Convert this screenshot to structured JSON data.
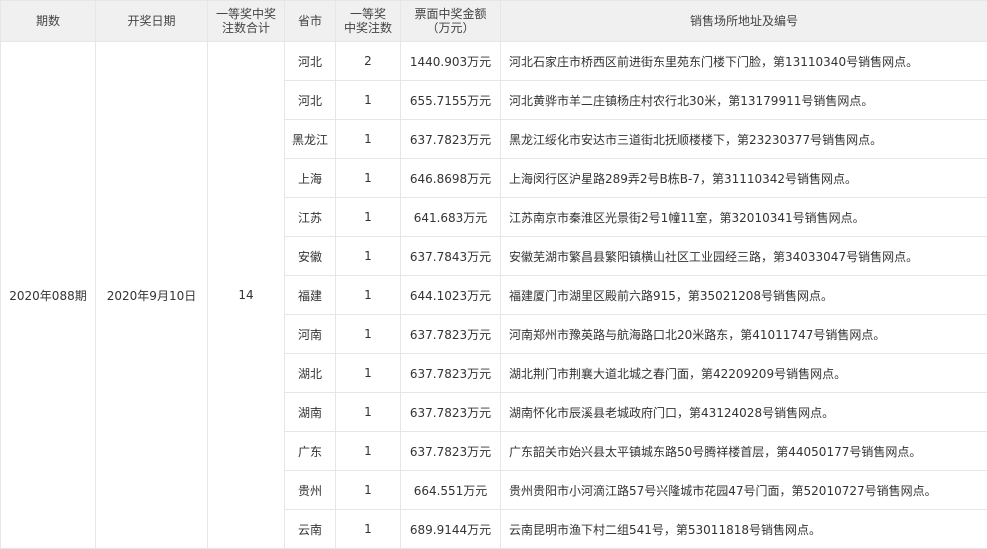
{
  "headers": {
    "period": "期数",
    "date": "开奖日期",
    "total_line1": "一等奖中奖",
    "total_line2": "注数合计",
    "province": "省市",
    "count_line1": "一等奖",
    "count_line2": "中奖注数",
    "amount_line1": "票面中奖金额",
    "amount_line2": "（万元）",
    "address": "销售场所地址及编号"
  },
  "draw": {
    "period": "2020年088期",
    "date": "2020年9月10日",
    "total": "14"
  },
  "rows": [
    {
      "province": "河北",
      "count": "2",
      "amount": "1440.903万元",
      "address": "河北石家庄市桥西区前进街东里苑东门楼下门脸，第13110340号销售网点。"
    },
    {
      "province": "河北",
      "count": "1",
      "amount": "655.7155万元",
      "address": "河北黄骅市羊二庄镇杨庄村农行北30米，第13179911号销售网点。"
    },
    {
      "province": "黑龙江",
      "count": "1",
      "amount": "637.7823万元",
      "address": "黑龙江绥化市安达市三道街北抚顺楼楼下，第23230377号销售网点。"
    },
    {
      "province": "上海",
      "count": "1",
      "amount": "646.8698万元",
      "address": "上海闵行区沪星路289弄2号B栋B-7，第31110342号销售网点。"
    },
    {
      "province": "江苏",
      "count": "1",
      "amount": "641.683万元",
      "address": "江苏南京市秦淮区光景街2号1幢11室，第32010341号销售网点。"
    },
    {
      "province": "安徽",
      "count": "1",
      "amount": "637.7843万元",
      "address": "安徽芜湖市繁昌县繁阳镇横山社区工业园经三路，第34033047号销售网点。"
    },
    {
      "province": "福建",
      "count": "1",
      "amount": "644.1023万元",
      "address": "福建厦门市湖里区殿前六路915，第35021208号销售网点。"
    },
    {
      "province": "河南",
      "count": "1",
      "amount": "637.7823万元",
      "address": "河南郑州市豫英路与航海路口北20米路东，第41011747号销售网点。"
    },
    {
      "province": "湖北",
      "count": "1",
      "amount": "637.7823万元",
      "address": "湖北荆门市荆襄大道北城之春门面，第42209209号销售网点。"
    },
    {
      "province": "湖南",
      "count": "1",
      "amount": "637.7823万元",
      "address": "湖南怀化市辰溪县老城政府门口，第43124028号销售网点。"
    },
    {
      "province": "广东",
      "count": "1",
      "amount": "637.7823万元",
      "address": "广东韶关市始兴县太平镇城东路50号腾祥楼首层，第44050177号销售网点。"
    },
    {
      "province": "贵州",
      "count": "1",
      "amount": "664.551万元",
      "address": "贵州贵阳市小河滴江路57号兴隆城市花园47号门面，第52010727号销售网点。"
    },
    {
      "province": "云南",
      "count": "1",
      "amount": "689.9144万元",
      "address": "云南昆明市渔下村二组541号，第53011818号销售网点。"
    }
  ]
}
